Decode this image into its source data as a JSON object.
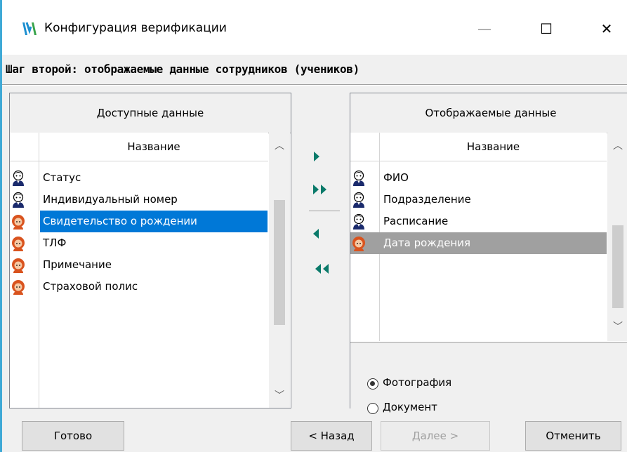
{
  "window": {
    "title": "Конфигурация верификации",
    "minimize_glyph": "—",
    "maximize_glyph": "☐",
    "close_glyph": "✕"
  },
  "step_title": "Шаг второй: отображаемые данные сотрудников (учеников)",
  "available": {
    "header": "Доступные данные",
    "column": "Название",
    "items": [
      {
        "label": "Статус",
        "icon": "employee-icon"
      },
      {
        "label": "Индивидуальный номер",
        "icon": "employee-icon"
      },
      {
        "label": "Свидетельство о рождении",
        "icon": "student-icon",
        "selected": true
      },
      {
        "label": "ТЛФ",
        "icon": "student-icon"
      },
      {
        "label": "Примечание",
        "icon": "student-icon"
      },
      {
        "label": "Страховой полис",
        "icon": "student-icon"
      }
    ]
  },
  "displayed": {
    "header": "Отображаемые данные",
    "column": "Название",
    "items": [
      {
        "label": "ФИО",
        "icon": "employee-icon"
      },
      {
        "label": "Подразделение",
        "icon": "employee-icon"
      },
      {
        "label": "Расписание",
        "icon": "employee-icon"
      },
      {
        "label": "Дата рождения",
        "icon": "student-icon",
        "selected": true
      }
    ]
  },
  "radio": {
    "photo": "Фотография",
    "document": "Документ",
    "selected": "photo"
  },
  "buttons": {
    "done": "Готово",
    "back": "< Назад",
    "next": "Далее >",
    "cancel": "Отменить"
  },
  "colors": {
    "selection_blue": "#0078d7",
    "selection_gray": "#a0a0a0",
    "arrow_teal": "#0a7a6a",
    "accent_bar": "#3fa9d6"
  }
}
